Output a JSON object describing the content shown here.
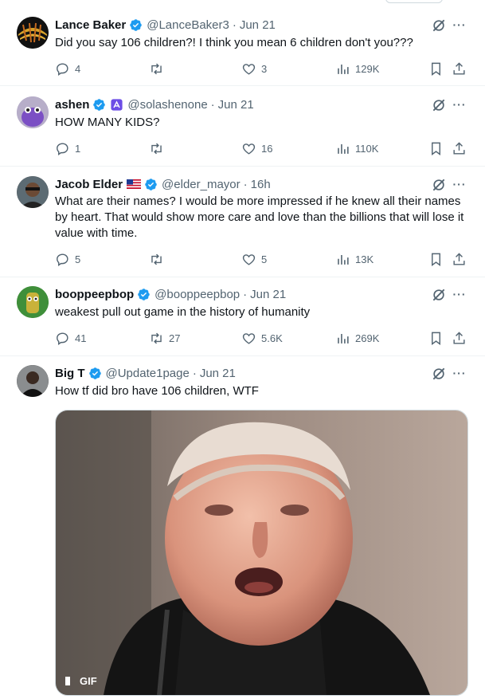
{
  "tweets": [
    {
      "name": "Lance Baker",
      "handle": "@LanceBaker3",
      "time": "Jun 21",
      "text": "Did you say 106 children?! I think you mean 6 children don't you???",
      "replies": "4",
      "reposts": "",
      "likes": "3",
      "views": "129K"
    },
    {
      "name": "ashen",
      "handle": "@solashenone",
      "time": "Jun 21",
      "text": "HOW MANY KIDS?",
      "replies": "1",
      "reposts": "",
      "likes": "16",
      "views": "110K"
    },
    {
      "name": "Jacob Elder",
      "handle": "@elder_mayor",
      "time": "16h",
      "text": "What are their names? I would be more impressed if he knew all their names by heart. That would show more care and love than the billions that will lose it value with time.",
      "replies": "5",
      "reposts": "",
      "likes": "5",
      "views": "13K"
    },
    {
      "name": "booppeepbop",
      "handle": "@booppeepbop",
      "time": "Jun 21",
      "text": "weakest pull out game in the history of humanity",
      "replies": "41",
      "reposts": "27",
      "likes": "5.6K",
      "views": "269K"
    },
    {
      "name": "Big T",
      "handle": "@Update1page",
      "time": "Jun 21",
      "text": "How tf did bro have 106 children, WTF",
      "gif_label": "GIF"
    }
  ],
  "icons": {
    "verified": "verified-badge-icon",
    "grok": "grok-icon",
    "more": "more-icon",
    "reply": "reply-icon",
    "repost": "repost-icon",
    "like": "like-icon",
    "views": "views-icon",
    "bookmark": "bookmark-icon",
    "share": "share-icon"
  },
  "colors": {
    "verified_blue": "#1d9bf0",
    "secondary_text": "#536471"
  }
}
